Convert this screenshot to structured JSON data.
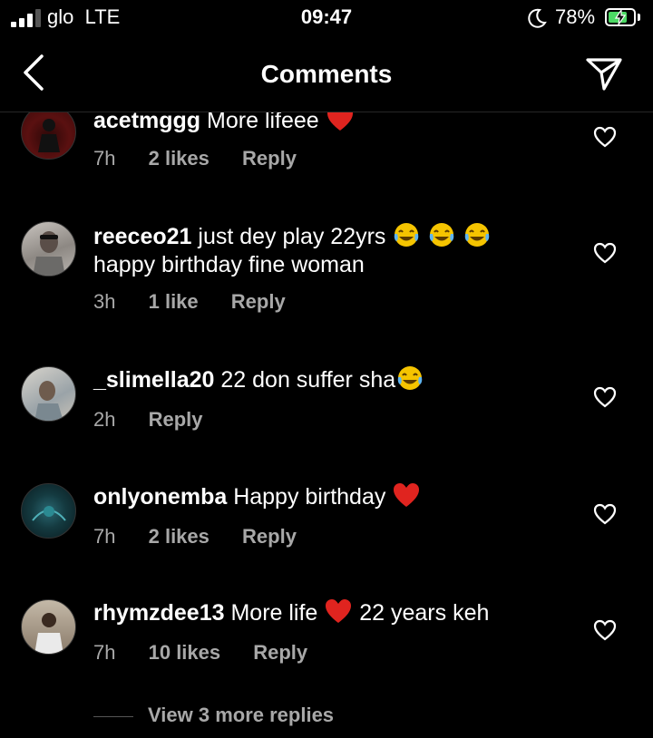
{
  "status_bar": {
    "carrier": "glo",
    "network": "LTE",
    "time": "09:47",
    "battery_percent": "78%",
    "battery_level": 0.78,
    "signal_bars_filled": 3,
    "signal_bars_total": 4,
    "icons": [
      "signal-icon",
      "moon-icon",
      "battery-charging-icon"
    ]
  },
  "header": {
    "title": "Comments",
    "left_icon": "back-chevron-icon",
    "right_icon": "send-icon"
  },
  "colors": {
    "background": "#000000",
    "text": "#ffffff",
    "secondary_text": "#a8a8a8",
    "heart_emoji": "#e0241f",
    "battery_fill": "#4cd964"
  },
  "comments": [
    {
      "username": "acetmggg",
      "text": " More lifeee",
      "emoji": [
        "red-heart-emoji"
      ],
      "time": "7h",
      "likes": "2 likes",
      "reply": "Reply"
    },
    {
      "username": "reeceo21",
      "text": " just dey play 22yrs",
      "emoji": [
        "tears-of-joy-emoji",
        "tears-of-joy-emoji",
        "tears-of-joy-emoji"
      ],
      "text2": "happy birthday fine woman",
      "time": "3h",
      "likes": "1 like",
      "reply": "Reply"
    },
    {
      "username": "_slimella20",
      "text": " 22 don suffer sha",
      "emoji": [
        "tears-of-joy-emoji"
      ],
      "time": "2h",
      "reply": "Reply"
    },
    {
      "username": "onlyonemba",
      "text": " Happy birthday ",
      "emoji": [
        "red-heart-emoji"
      ],
      "time": "7h",
      "likes": "2 likes",
      "reply": "Reply"
    },
    {
      "username": "rhymzdee13",
      "text": " More life ",
      "emoji": [
        "red-heart-emoji"
      ],
      "text2": "  22 years keh",
      "time": "7h",
      "likes": "10 likes",
      "reply": "Reply"
    }
  ],
  "view_more_replies": "View 3 more replies"
}
